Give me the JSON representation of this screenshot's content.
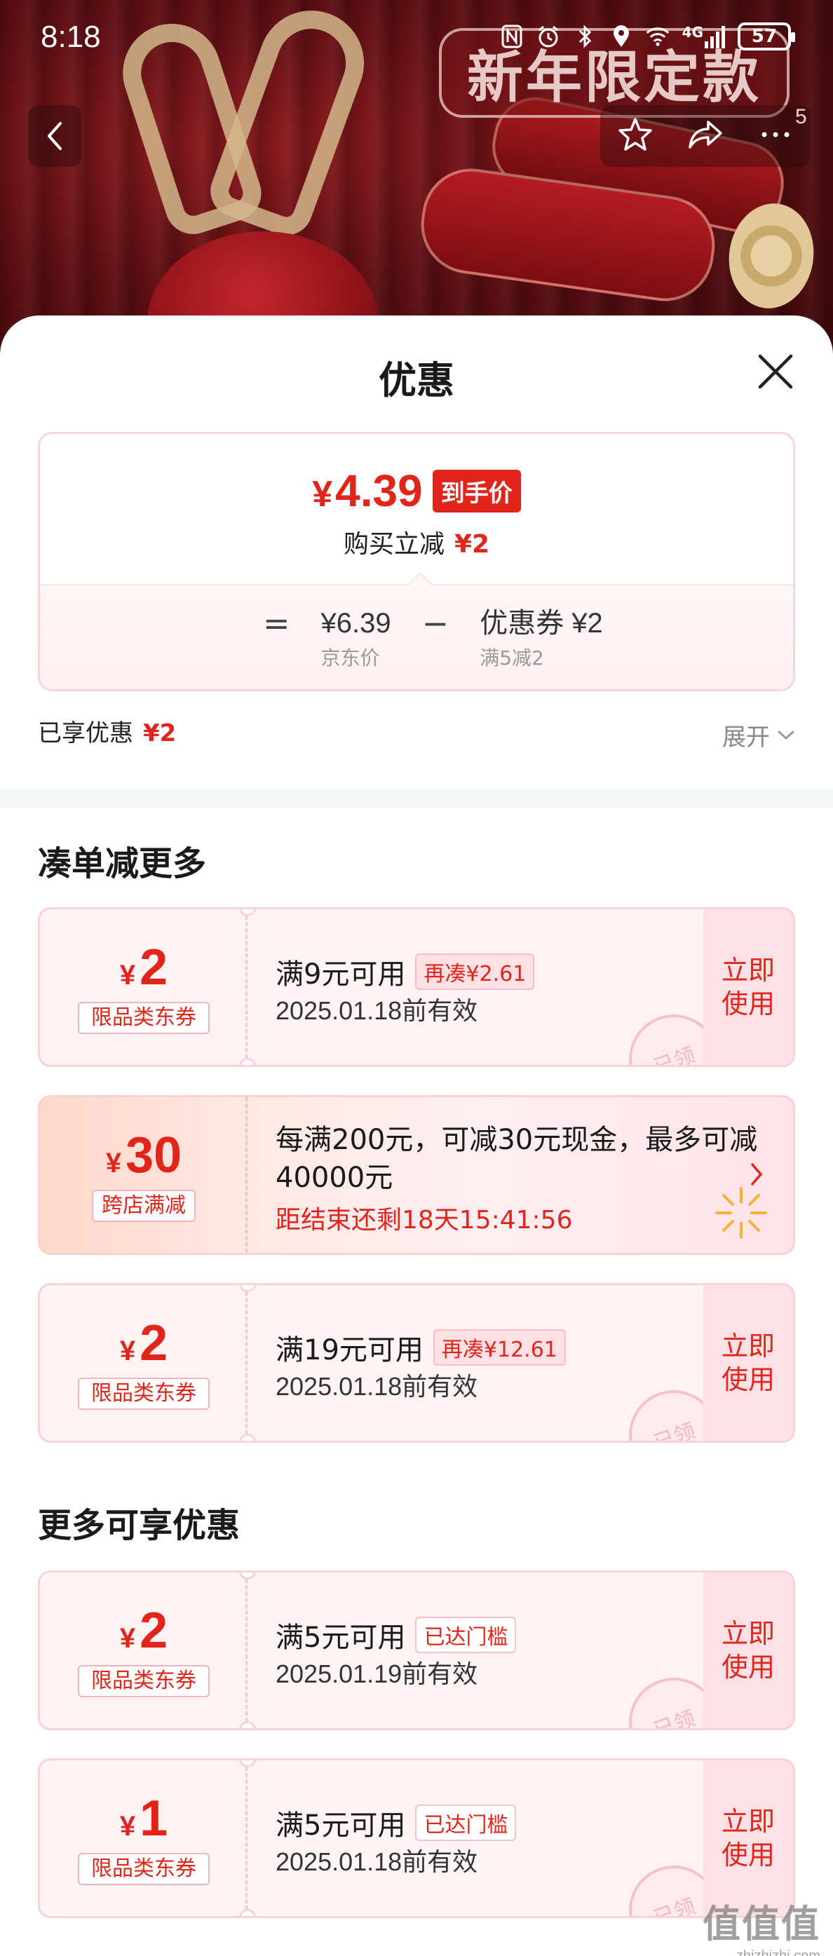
{
  "status_bar": {
    "time": "8:18",
    "network": "4G",
    "battery": "57",
    "icons": [
      "nfc-icon",
      "alarm-icon",
      "bluetooth-icon",
      "location-icon",
      "wifi-icon",
      "signal-icon",
      "battery-icon"
    ]
  },
  "banner": {
    "badge_text": "新年限定款",
    "nav_badge_count": "5",
    "icons": [
      "back-icon",
      "star-icon",
      "share-icon",
      "more-icon"
    ]
  },
  "sheet": {
    "title": "优惠",
    "close_icon": "close-icon"
  },
  "summary": {
    "final_price_yen": "¥",
    "final_price": "4.39",
    "final_price_tag": "到手价",
    "reduce_label": "购买立减",
    "reduce_amount": "¥2",
    "equals": "=",
    "minus": "−",
    "jd_price": "¥6.39",
    "jd_price_label": "京东价",
    "coupon_value": "优惠券 ¥2",
    "coupon_rule": "满5减2"
  },
  "enjoyed": {
    "label": "已享优惠",
    "amount": "¥2",
    "expand_label": "展开"
  },
  "sections": {
    "more_order": "凑单减更多",
    "more_benefits": "更多可享优惠"
  },
  "coupons_order": [
    {
      "yen": "¥",
      "amount": "2",
      "kind": "限品类东券",
      "condition": "满9元可用",
      "tag": "再凑¥2.61",
      "valid": "2025.01.18前有效",
      "use_line1": "立即",
      "use_line2": "使用",
      "stamp": "已领"
    },
    {
      "yen": "¥",
      "amount": "2",
      "kind": "限品类东券",
      "condition": "满19元可用",
      "tag": "再凑¥12.61",
      "valid": "2025.01.18前有效",
      "use_line1": "立即",
      "use_line2": "使用",
      "stamp": "已领"
    }
  ],
  "promo": {
    "yen": "¥",
    "amount": "30",
    "kind": "跨店满减",
    "description": "每满200元，可减30元现金，最多可减40000元",
    "countdown": "距结束还剩18天15:41:56",
    "arrow_icon": "chevron-right-icon"
  },
  "coupons_more": [
    {
      "yen": "¥",
      "amount": "2",
      "kind": "限品类东券",
      "condition": "满5元可用",
      "tag": "已达门槛",
      "valid": "2025.01.19前有效",
      "use_line1": "立即",
      "use_line2": "使用",
      "stamp": "已领"
    },
    {
      "yen": "¥",
      "amount": "1",
      "kind": "限品类东券",
      "condition": "满5元可用",
      "tag": "已达门槛",
      "valid": "2025.01.18前有效",
      "use_line1": "立即",
      "use_line2": "使用",
      "stamp": "已领"
    }
  ],
  "watermark": {
    "big": "值值值",
    "small": "zhizhizhi.com"
  },
  "colors": {
    "accent_red": "#e1251b",
    "coupon_bg": "#fff3f5",
    "banner_dark": "#5e0f13"
  }
}
